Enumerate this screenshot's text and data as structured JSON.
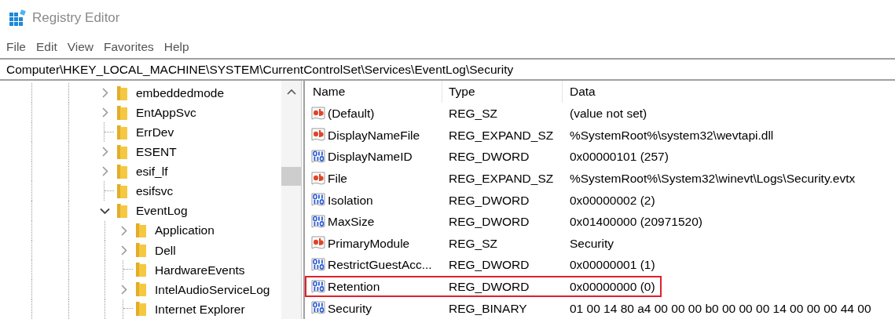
{
  "window": {
    "title": "Registry Editor"
  },
  "menu": [
    "File",
    "Edit",
    "View",
    "Favorites",
    "Help"
  ],
  "address": "Computer\\HKEY_LOCAL_MACHINE\\SYSTEM\\CurrentControlSet\\Services\\EventLog\\Security",
  "tree": [
    {
      "label": "embeddedmode",
      "kind": "branch",
      "expanded": false
    },
    {
      "label": "EntAppSvc",
      "kind": "branch",
      "expanded": false
    },
    {
      "label": "ErrDev",
      "kind": "leaf"
    },
    {
      "label": "ESENT",
      "kind": "branch",
      "expanded": false
    },
    {
      "label": "esif_lf",
      "kind": "branch",
      "expanded": false
    },
    {
      "label": "esifsvc",
      "kind": "leaf"
    },
    {
      "label": "EventLog",
      "kind": "branch",
      "expanded": true,
      "children": [
        {
          "label": "Application",
          "kind": "branch",
          "expanded": false
        },
        {
          "label": "Dell",
          "kind": "branch",
          "expanded": false
        },
        {
          "label": "HardwareEvents",
          "kind": "leaf"
        },
        {
          "label": "IntelAudioServiceLog",
          "kind": "branch",
          "expanded": false
        },
        {
          "label": "Internet Explorer",
          "kind": "leaf"
        }
      ]
    }
  ],
  "table": {
    "columns": [
      "Name",
      "Type",
      "Data"
    ],
    "rows": [
      {
        "kind": "string",
        "name": "(Default)",
        "type": "REG_SZ",
        "data": "(value not set)",
        "highlighted": false
      },
      {
        "kind": "string",
        "name": "DisplayNameFile",
        "type": "REG_EXPAND_SZ",
        "data": "%SystemRoot%\\system32\\wevtapi.dll",
        "highlighted": false
      },
      {
        "kind": "binary",
        "name": "DisplayNameID",
        "type": "REG_DWORD",
        "data": "0x00000101 (257)",
        "highlighted": false
      },
      {
        "kind": "string",
        "name": "File",
        "type": "REG_EXPAND_SZ",
        "data": "%SystemRoot%\\System32\\winevt\\Logs\\Security.evtx",
        "highlighted": false
      },
      {
        "kind": "binary",
        "name": "Isolation",
        "type": "REG_DWORD",
        "data": "0x00000002 (2)",
        "highlighted": false
      },
      {
        "kind": "binary",
        "name": "MaxSize",
        "type": "REG_DWORD",
        "data": "0x01400000 (20971520)",
        "highlighted": false
      },
      {
        "kind": "string",
        "name": "PrimaryModule",
        "type": "REG_SZ",
        "data": "Security",
        "highlighted": false
      },
      {
        "kind": "binary",
        "name": "RestrictGuestAcc...",
        "type": "REG_DWORD",
        "data": "0x00000001 (1)",
        "highlighted": false
      },
      {
        "kind": "binary",
        "name": "Retention",
        "type": "REG_DWORD",
        "data": "0x00000000 (0)",
        "highlighted": true
      },
      {
        "kind": "binary",
        "name": "Security",
        "type": "REG_BINARY",
        "data": "01 00 14 80 a4 00 00 00 b0 00 00 00 14 00 00 00 44 00",
        "highlighted": false
      }
    ]
  }
}
